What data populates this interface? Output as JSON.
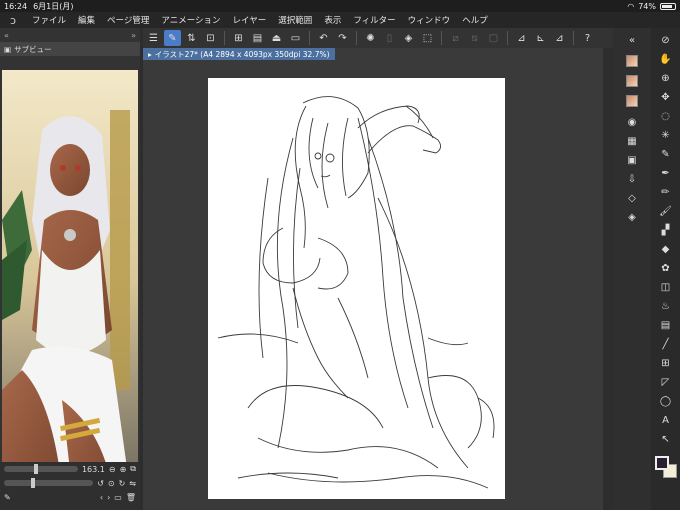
{
  "status": {
    "time": "16:24",
    "date": "6月1日(月)",
    "battery": "74%"
  },
  "menu": {
    "items": [
      "ファイル",
      "編集",
      "ページ管理",
      "アニメーション",
      "レイヤー",
      "選択範囲",
      "表示",
      "フィルター",
      "ウィンドウ",
      "ヘルプ"
    ]
  },
  "left_panel": {
    "tab_label": "サブビュー",
    "zoom_value": "163.1"
  },
  "document": {
    "tab_label": "イラスト27* (A4 2894 x 4093px 350dpi 32.7%)"
  },
  "colors": {
    "accent": "#4a7cc7",
    "doc_tab": "#4b6f9e",
    "foreground": "#2a1f2e",
    "background": "#f4eed8"
  }
}
